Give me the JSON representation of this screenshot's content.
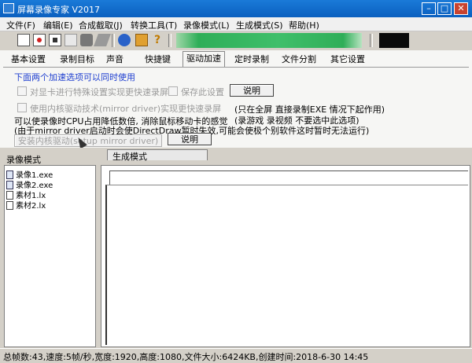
{
  "window": {
    "title": "屏幕录像专家 V2017",
    "min_glyph": "–",
    "max_glyph": "□",
    "close_glyph": "✕"
  },
  "menu": [
    "文件(F)",
    "编辑(E)",
    "合成截取(J)",
    "转换工具(T)",
    "录像模式(L)",
    "生成模式(S)",
    "帮助(H)"
  ],
  "colors": {
    "title_bar": "#0a5fbf",
    "progress_green": "#2fae58",
    "note_blue": "#1f3fd0"
  },
  "toolbar": {
    "icons": [
      "open-icon",
      "record-icon",
      "stop-icon",
      "camera-icon",
      "brush-icon",
      "globe-icon",
      "gift-icon",
      "help-icon"
    ]
  },
  "tabs": [
    "基本设置",
    "录制目标",
    "声音",
    "快捷键",
    "驱动加速",
    "定时录制",
    "文件分割",
    "其它设置"
  ],
  "active_tab": "驱动加速",
  "accel": {
    "note": "下面两个加速选项可以同时使用",
    "opt1": "对显卡进行特殊设置实现更快速录屏",
    "opt2": "保存此设置",
    "btn_explain1": "说明",
    "opt3": "使用内核驱动技术(mirror driver)实现更快速录屏",
    "info_line1": "(只在全屏 直接录制EXE 情况下起作用)",
    "info_line2": "(录游戏 录视频 不要选中此选项)",
    "cpu_line": "可以使录像时CPU占用降低数倍, 消除鼠标移动卡的感觉",
    "warn_line": "(由于mirror driver启动时会使DirectDraw暂时失效,可能会使极个别软件这时暂时无法运行)",
    "install_btn": "安装内核驱动(setup mirror driver)",
    "btn_explain2": "说明"
  },
  "panes": {
    "left_label": "录像模式",
    "right_label": "生成模式"
  },
  "files": [
    {
      "name": "录像1.exe",
      "type": "exe"
    },
    {
      "name": "录像2.exe",
      "type": "exe"
    },
    {
      "name": "素材1.lx",
      "type": "lx"
    },
    {
      "name": "素材2.lx",
      "type": "lx"
    }
  ],
  "status": "总帧数:43,速度:5帧/秒,宽度:1920,高度:1080,文件大小:6424KB,创建时间:2018-6-30 14:45"
}
